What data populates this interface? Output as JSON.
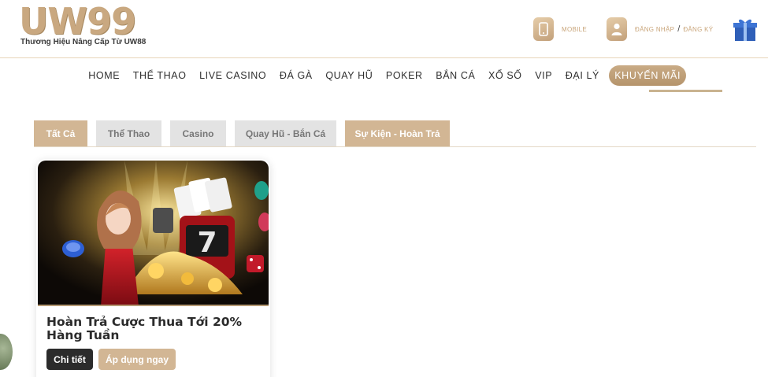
{
  "header": {
    "logo_main": "UW99",
    "logo_tagline": "Thương Hiệu Nâng Cấp Từ UW88",
    "mobile_label": "MOBILE",
    "login_label": "ĐĂNG NHẬP",
    "separator": "/",
    "register_label": "ĐĂNG KÝ"
  },
  "nav": {
    "items": [
      "HOME",
      "THỂ THAO",
      "LIVE CASINO",
      "ĐÁ GÀ",
      "QUAY HŨ",
      "POKER",
      "BẮN CÁ",
      "XỔ SỐ",
      "VIP",
      "ĐẠI LÝ",
      "KHUYẾN MÃI"
    ],
    "active": "KHUYẾN MÃI"
  },
  "tabs": {
    "items": [
      "Tất Cả",
      "Thể Thao",
      "Casino",
      "Quay Hũ - Bắn Cá",
      "Sự Kiện - Hoàn Trả"
    ],
    "active": "Tất Cả"
  },
  "promo": {
    "title": "Hoàn Trả Cược Thua Tới 20% Hàng Tuần",
    "detail_button": "Chi tiết",
    "apply_button": "Áp dụng ngay"
  },
  "colors": {
    "gold": "#d2b694",
    "gold_dark": "#b5946c",
    "tab_grey": "#e3e3e3",
    "text_dark": "#2b2b2b"
  },
  "icons": {
    "mobile": "mobile-phone-icon",
    "user": "user-icon",
    "gift": "gift-box-icon"
  }
}
